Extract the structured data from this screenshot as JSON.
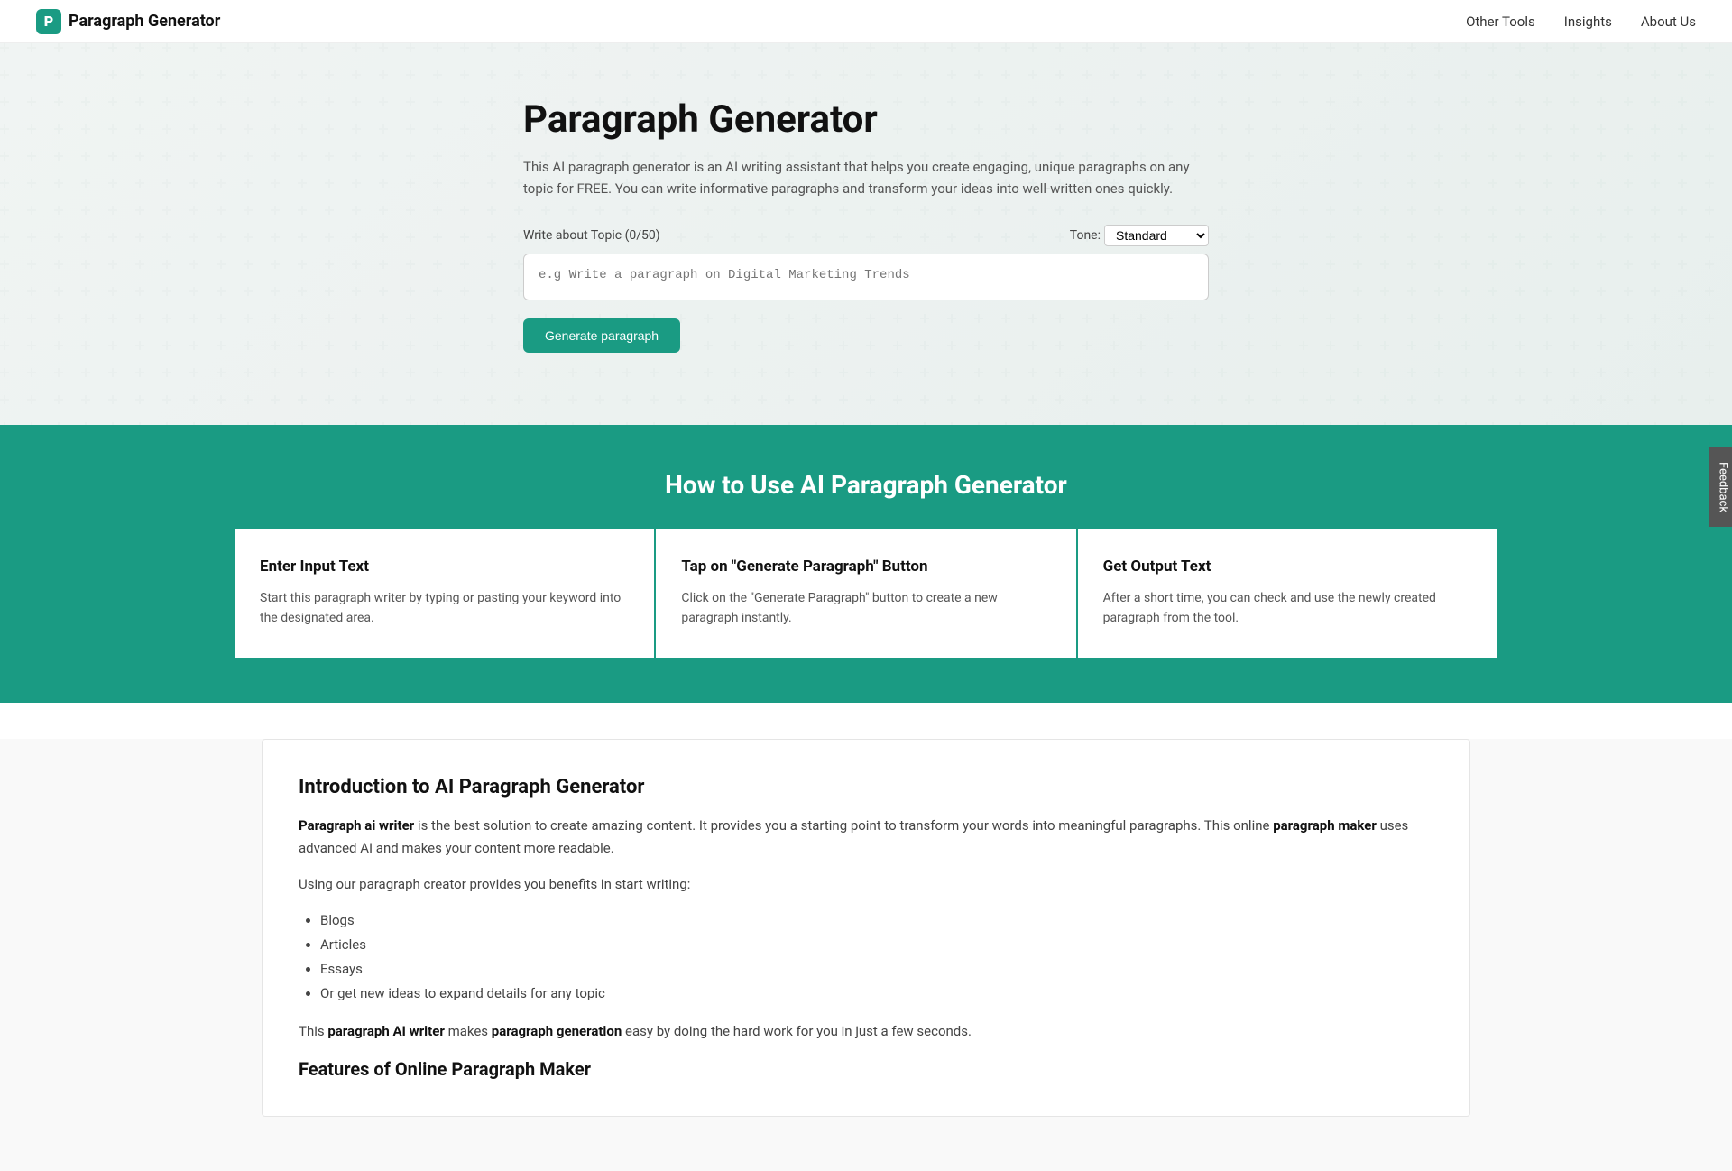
{
  "nav": {
    "logo_text": "Paragraph Generator",
    "logo_letter": "P",
    "links": [
      {
        "label": "Other Tools",
        "id": "other-tools"
      },
      {
        "label": "Insights",
        "id": "insights"
      },
      {
        "label": "About Us",
        "id": "about-us"
      }
    ]
  },
  "hero": {
    "title": "Paragraph Generator",
    "description": "This AI paragraph generator is an AI writing assistant that helps you create engaging, unique paragraphs on any topic for FREE. You can write informative paragraphs and transform your ideas into well-written ones quickly.",
    "topic_label": "Write about Topic (0/50)",
    "topic_placeholder": "e.g Write a paragraph on Digital Marketing Trends",
    "tone_label": "Tone:",
    "tone_default": "Standard",
    "generate_btn": "Generate paragraph"
  },
  "how_to": {
    "title": "How to Use AI Paragraph Generator",
    "steps": [
      {
        "title": "Enter Input Text",
        "description": "Start this paragraph writer by typing or pasting your keyword into the designated area."
      },
      {
        "title": "Tap on \"Generate Paragraph\" Button",
        "description": "Click on the \"Generate Paragraph\" button to create a new paragraph instantly."
      },
      {
        "title": "Get Output Text",
        "description": "After a short time, you can check and use the newly created paragraph from the tool."
      }
    ]
  },
  "intro": {
    "title": "Introduction to AI Paragraph Generator",
    "paragraph1_start": "",
    "paragraph1_link1": "Paragraph ai writer",
    "paragraph1_middle": " is the best solution to create amazing content. It provides you a starting point to transform your words into meaningful paragraphs. This online ",
    "paragraph1_link2": "paragraph maker",
    "paragraph1_end": " uses advanced AI and makes your content more readable.",
    "paragraph2": "Using our paragraph creator provides you benefits in start writing:",
    "list_items": [
      "Blogs",
      "Articles",
      "Essays",
      "Or get new ideas to expand details for any topic"
    ],
    "paragraph3_start": "This ",
    "paragraph3_link1": "paragraph AI writer",
    "paragraph3_middle": " makes ",
    "paragraph3_link2": "paragraph generation",
    "paragraph3_end": " easy by doing the hard work for you in just a few seconds.",
    "features_title": "Features of Online Paragraph Maker"
  },
  "feedback": {
    "label": "Feedback"
  }
}
